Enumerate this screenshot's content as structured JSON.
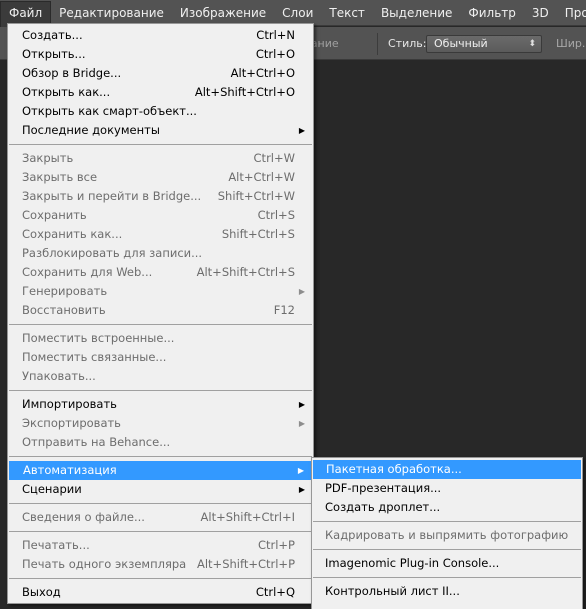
{
  "menubar": {
    "items": [
      {
        "label": "Файл",
        "active": true
      },
      {
        "label": "Редактирование"
      },
      {
        "label": "Изображение"
      },
      {
        "label": "Слои"
      },
      {
        "label": "Текст"
      },
      {
        "label": "Выделение"
      },
      {
        "label": "Фильтр"
      },
      {
        "label": "3D"
      },
      {
        "label": "Просмотр"
      }
    ]
  },
  "options_bar": {
    "antialias_label": "Сглаживание",
    "style_label": "Стиль:",
    "style_value": "Обычный",
    "width_label": "Шир.:"
  },
  "file_menu": {
    "groups": [
      [
        {
          "label": "Создать...",
          "shortcut": "Ctrl+N",
          "enabled": true
        },
        {
          "label": "Открыть...",
          "shortcut": "Ctrl+O",
          "enabled": true
        },
        {
          "label": "Обзор в Bridge...",
          "shortcut": "Alt+Ctrl+O",
          "enabled": true
        },
        {
          "label": "Открыть как...",
          "shortcut": "Alt+Shift+Ctrl+O",
          "enabled": true
        },
        {
          "label": "Открыть как смарт-объект...",
          "shortcut": "",
          "enabled": true
        },
        {
          "label": "Последние документы",
          "shortcut": "",
          "enabled": true,
          "submenu": true
        }
      ],
      [
        {
          "label": "Закрыть",
          "shortcut": "Ctrl+W",
          "enabled": false
        },
        {
          "label": "Закрыть все",
          "shortcut": "Alt+Ctrl+W",
          "enabled": false
        },
        {
          "label": "Закрыть и перейти в Bridge...",
          "shortcut": "Shift+Ctrl+W",
          "enabled": false
        },
        {
          "label": "Сохранить",
          "shortcut": "Ctrl+S",
          "enabled": false
        },
        {
          "label": "Сохранить как...",
          "shortcut": "Shift+Ctrl+S",
          "enabled": false
        },
        {
          "label": "Разблокировать для записи...",
          "shortcut": "",
          "enabled": false
        },
        {
          "label": "Сохранить для Web...",
          "shortcut": "Alt+Shift+Ctrl+S",
          "enabled": false
        },
        {
          "label": "Генерировать",
          "shortcut": "",
          "enabled": false,
          "submenu": true
        },
        {
          "label": "Восстановить",
          "shortcut": "F12",
          "enabled": false
        }
      ],
      [
        {
          "label": "Поместить встроенные...",
          "shortcut": "",
          "enabled": false
        },
        {
          "label": "Поместить связанные...",
          "shortcut": "",
          "enabled": false
        },
        {
          "label": "Упаковать...",
          "shortcut": "",
          "enabled": false
        }
      ],
      [
        {
          "label": "Импортировать",
          "shortcut": "",
          "enabled": true,
          "submenu": true
        },
        {
          "label": "Экспортировать",
          "shortcut": "",
          "enabled": false,
          "submenu": true
        },
        {
          "label": "Отправить на Behance...",
          "shortcut": "",
          "enabled": false
        }
      ],
      [
        {
          "label": "Автоматизация",
          "shortcut": "",
          "enabled": true,
          "submenu": true,
          "highlighted": true
        },
        {
          "label": "Сценарии",
          "shortcut": "",
          "enabled": true,
          "submenu": true
        }
      ],
      [
        {
          "label": "Сведения о файле...",
          "shortcut": "Alt+Shift+Ctrl+I",
          "enabled": false
        }
      ],
      [
        {
          "label": "Печатать...",
          "shortcut": "Ctrl+P",
          "enabled": false
        },
        {
          "label": "Печать одного экземпляра",
          "shortcut": "Alt+Shift+Ctrl+P",
          "enabled": false
        }
      ],
      [
        {
          "label": "Выход",
          "shortcut": "Ctrl+Q",
          "enabled": true
        }
      ]
    ]
  },
  "automation_submenu": {
    "groups": [
      [
        {
          "label": "Пакетная обработка...",
          "enabled": true,
          "highlighted": true
        },
        {
          "label": "PDF-презентация...",
          "enabled": true
        },
        {
          "label": "Создать дроплет...",
          "enabled": true
        }
      ],
      [
        {
          "label": "Кадрировать и выпрямить фотографию",
          "enabled": false
        }
      ],
      [
        {
          "label": "Imagenomic Plug-in Console...",
          "enabled": true
        }
      ],
      [
        {
          "label": "Контрольный лист II...",
          "enabled": true
        }
      ]
    ]
  },
  "icons": {
    "submenu_arrow": "▶",
    "select_updown": "⬍"
  },
  "colors": {
    "highlight": "#3399ff",
    "menu_bg": "#f0f0f0",
    "ui_bg": "#535353",
    "canvas_bg": "#282828"
  }
}
